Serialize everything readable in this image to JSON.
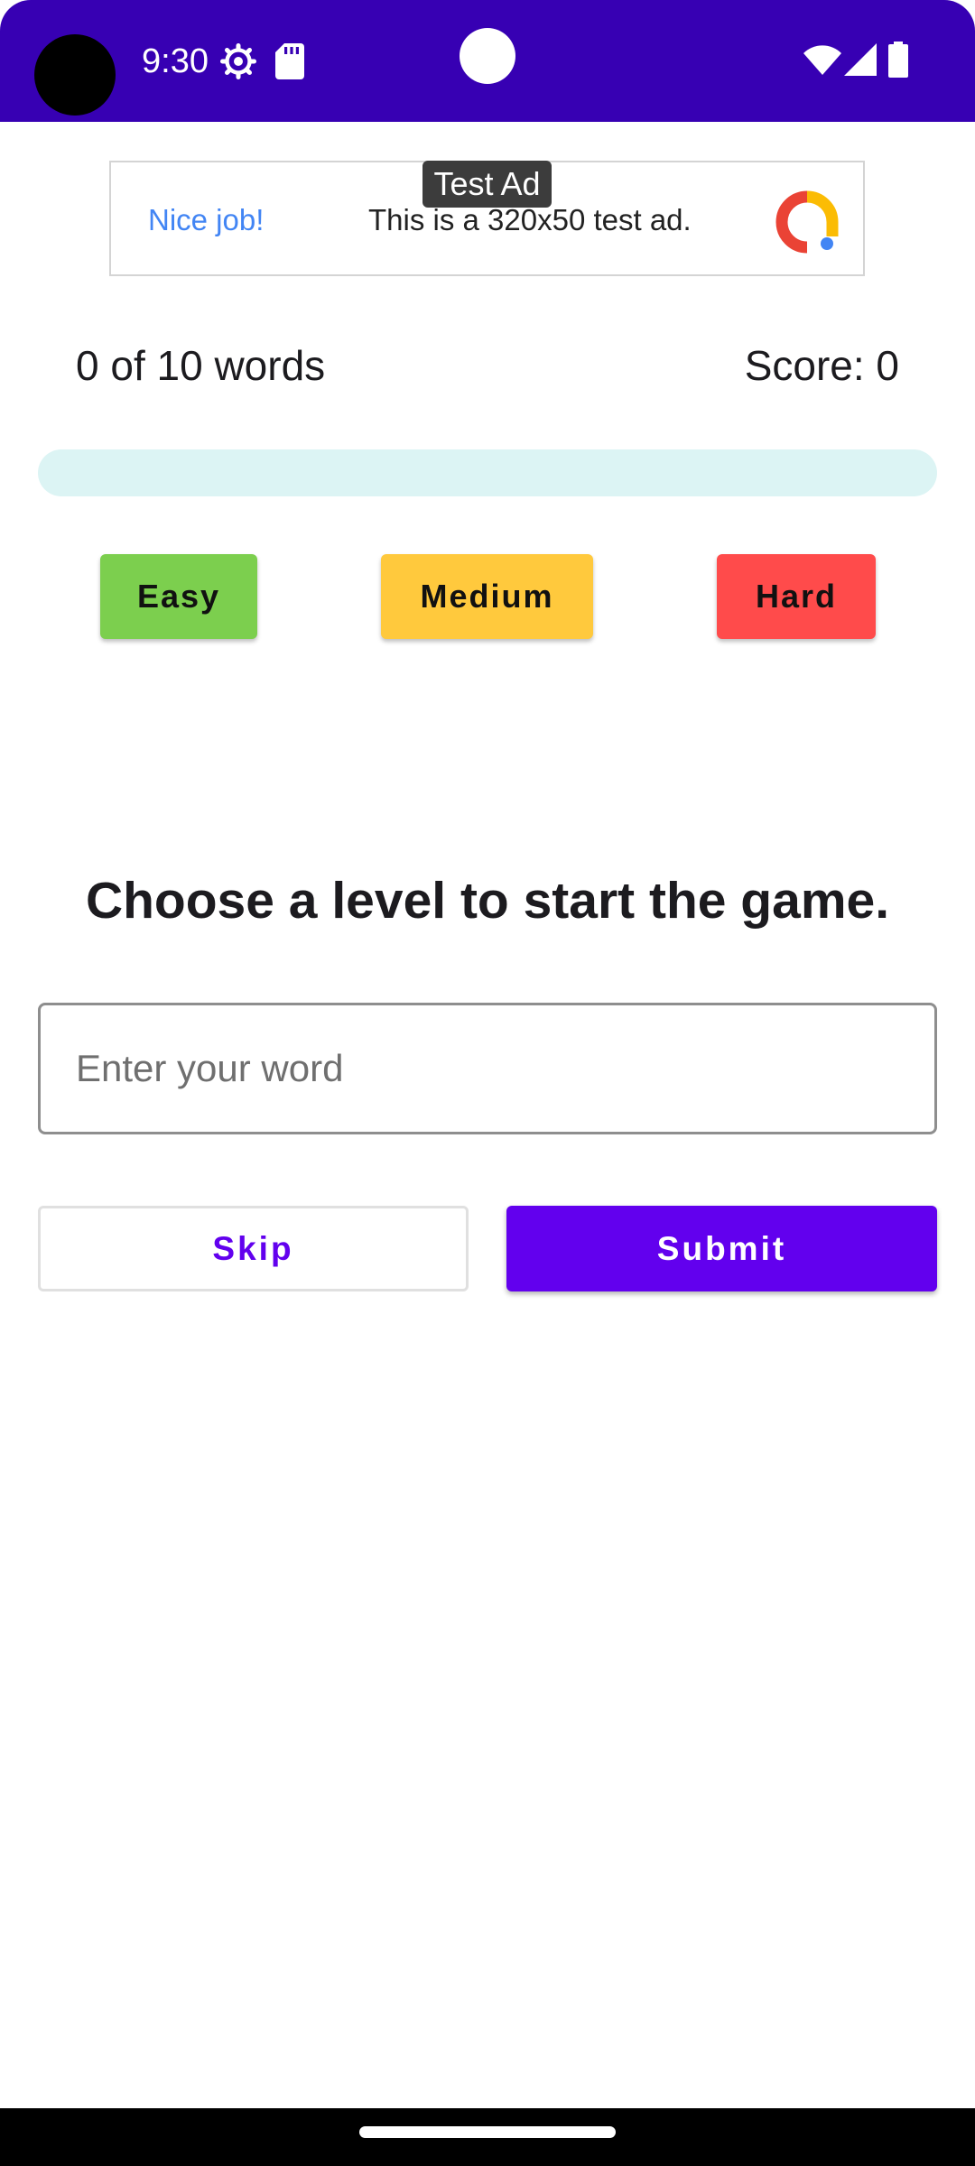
{
  "status_bar": {
    "time": "9:30",
    "background": "#3700b3",
    "icons": [
      "settings-icon",
      "sd-card-icon",
      "wifi-icon",
      "signal-icon",
      "battery-icon"
    ]
  },
  "ad": {
    "tag": "Test Ad",
    "headline": "Nice job!",
    "body": "This is a 320x50 test ad.",
    "logo": "admob-logo"
  },
  "game": {
    "words_count": "0 of 10 words",
    "score": "Score: 0",
    "progress": 0,
    "prompt": "Choose a level to start the game."
  },
  "levels": [
    {
      "label": "Easy",
      "color": "#7ccf4e"
    },
    {
      "label": "Medium",
      "color": "#ffc93d"
    },
    {
      "label": "Hard",
      "color": "#ff4b4b"
    }
  ],
  "input": {
    "placeholder": "Enter your word",
    "value": ""
  },
  "actions": {
    "skip_label": "Skip",
    "submit_label": "Submit",
    "accent": "#6200ee"
  }
}
